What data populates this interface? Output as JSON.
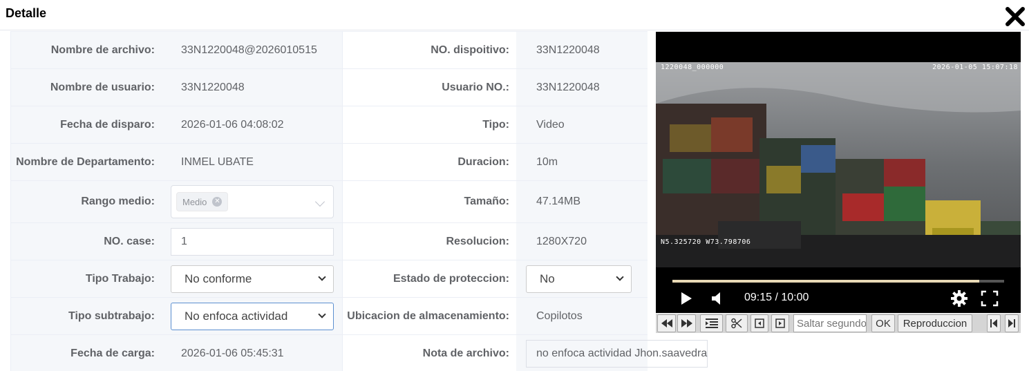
{
  "dialog": {
    "title": "Detalle"
  },
  "rows": [
    {
      "label1": "Nombre de archivo:",
      "value1": "33N1220048@2026010515",
      "label2": "NO. dispoitivo:",
      "value2": "33N1220048"
    },
    {
      "label1": "Nombre de usuario:",
      "value1": "33N1220048",
      "label2": "Usuario NO.:",
      "value2": "33N1220048"
    },
    {
      "label1": "Fecha de disparo:",
      "value1": "2026-01-06 04:08:02",
      "label2": "Tipo:",
      "value2": "Video"
    },
    {
      "label1": "Nombre de Departamento:",
      "value1": "INMEL UBATE",
      "label2": "Duracion:",
      "value2": "10m"
    },
    {
      "label1": "Rango medio:",
      "tag": "Medio",
      "label2": "Tamaño:",
      "value2": "47.14MB"
    },
    {
      "label1": "NO. case:",
      "input_value": "1",
      "label2": "Resolucion:",
      "value2": "1280X720"
    },
    {
      "label1": "Tipo Trabajo:",
      "select_value": "No conforme",
      "label2": "Estado de proteccion:",
      "select2_value": "No"
    },
    {
      "label1": "Tipo subtrabajo:",
      "select_value": "No enfoca actividad",
      "label2": "Ubicacion de almacenamiento:",
      "value2": "Copilotos"
    },
    {
      "label1": "Fecha de carga:",
      "value1": "2026-01-06 05:45:31",
      "label2": "Nota de archivo:",
      "note": "no enfoca actividad Jhon.saavedra"
    }
  ],
  "video": {
    "osd_top_left": "1220048_000000",
    "osd_top_right": "2026-01-05  15:07:18",
    "osd_gps": "N5.325720  W73.798706",
    "time": "09:15 / 10:00",
    "progress_fraction": 0.925
  },
  "toolbar": {
    "seek_placeholder": "Saltar segundos",
    "ok_label": "OK",
    "play_label": "Reproduccion"
  },
  "colors": {
    "label_bg": "#f5f7fa",
    "border": "#ebeef5",
    "text": "#606266",
    "progress": "#e9d9b5"
  }
}
